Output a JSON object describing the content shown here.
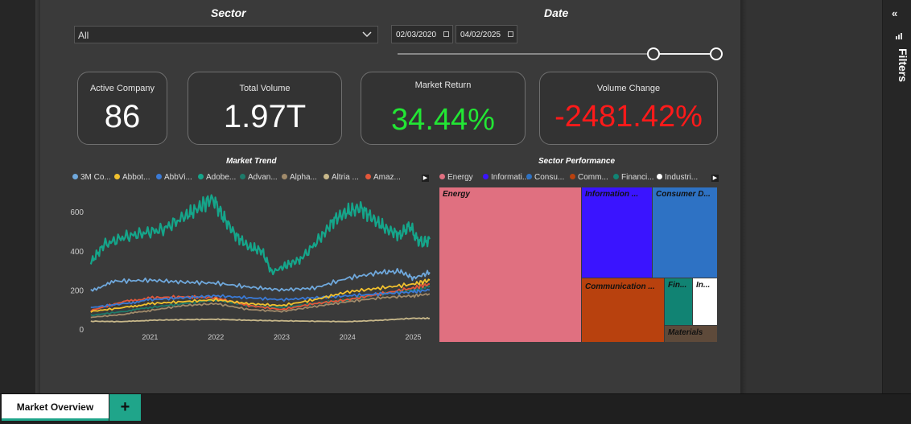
{
  "slicers": {
    "sector_title": "Sector",
    "sector_value": "All",
    "date_title": "Date",
    "date_start": "02/03/2020",
    "date_end": "04/02/2025",
    "range_start_fraction": 0.81,
    "range_end_fraction": 1.0
  },
  "kpis": {
    "active_company": {
      "label": "Active Company",
      "value": "86"
    },
    "total_volume": {
      "label": "Total Volume",
      "value": "1.97T"
    },
    "market_return": {
      "label": "Market Return",
      "value": "34.44%",
      "color": "#22e634"
    },
    "volume_change": {
      "label": "Volume Change",
      "value": "-2481.42%",
      "color": "#ff1a1a"
    }
  },
  "market_trend": {
    "title": "Market Trend",
    "legend": [
      {
        "name": "3M Co...",
        "color": "#6fa8dc"
      },
      {
        "name": "Abbot...",
        "color": "#f2c12e"
      },
      {
        "name": "AbbVi...",
        "color": "#3a7ad6"
      },
      {
        "name": "Adobe...",
        "color": "#15a58a"
      },
      {
        "name": "Advan...",
        "color": "#1e7a6a"
      },
      {
        "name": "Alpha...",
        "color": "#a08a6a"
      },
      {
        "name": "Altria ...",
        "color": "#c8b88a"
      },
      {
        "name": "Amaz...",
        "color": "#e4573a"
      }
    ]
  },
  "sector_performance": {
    "title": "Sector Performance",
    "legend": [
      {
        "name": "Energy",
        "color": "#e07080"
      },
      {
        "name": "Informati...",
        "color": "#3a14ff"
      },
      {
        "name": "Consu...",
        "color": "#2e72c4"
      },
      {
        "name": "Comm...",
        "color": "#b8410e"
      },
      {
        "name": "Financi...",
        "color": "#118373"
      },
      {
        "name": "Industri...",
        "color": "#ffffff"
      }
    ],
    "cells": {
      "energy": "Energy",
      "information": "Information ...",
      "consumer": "Consumer D...",
      "communication": "Communication ...",
      "financials": "Fin...",
      "industrials": "In...",
      "materials": "Materials"
    }
  },
  "chart_data": {
    "type": "line",
    "title": "Market Trend",
    "xlabel": "",
    "ylabel": "",
    "x_ticks": [
      "2021",
      "2022",
      "2023",
      "2024",
      "2025"
    ],
    "y_ticks": [
      0,
      200,
      400,
      600
    ],
    "ylim": [
      0,
      720
    ],
    "xlim": [
      "2020-02-03",
      "2025-04-02"
    ],
    "series": [
      {
        "name": "3M Co...",
        "color": "#6fa8dc",
        "x": [
          2020.1,
          2020.5,
          2021.0,
          2021.5,
          2022.0,
          2022.5,
          2023.0,
          2023.5,
          2024.0,
          2024.5,
          2024.8,
          2025.0,
          2025.25
        ],
        "y": [
          200,
          245,
          250,
          240,
          235,
          215,
          200,
          210,
          260,
          290,
          295,
          260,
          290
        ]
      },
      {
        "name": "Abbot...",
        "color": "#f2c12e",
        "x": [
          2020.1,
          2020.6,
          2021.0,
          2021.5,
          2022.0,
          2022.5,
          2023.0,
          2023.5,
          2024.0,
          2024.5,
          2025.0,
          2025.25
        ],
        "y": [
          90,
          110,
          130,
          140,
          150,
          130,
          120,
          150,
          190,
          210,
          230,
          250
        ]
      },
      {
        "name": "AbbVi...",
        "color": "#3a7ad6",
        "x": [
          2020.1,
          2020.6,
          2021.0,
          2021.5,
          2022.0,
          2022.5,
          2023.0,
          2023.5,
          2024.0,
          2024.5,
          2025.0,
          2025.25
        ],
        "y": [
          110,
          130,
          150,
          160,
          170,
          160,
          150,
          160,
          170,
          180,
          190,
          200
        ]
      },
      {
        "name": "Adobe...",
        "color": "#15a58a",
        "x": [
          2020.1,
          2020.3,
          2020.6,
          2020.9,
          2021.2,
          2021.5,
          2021.7,
          2021.95,
          2022.1,
          2022.3,
          2022.5,
          2022.7,
          2022.85,
          2023.1,
          2023.3,
          2023.6,
          2023.8,
          2024.0,
          2024.2,
          2024.4,
          2024.6,
          2024.8,
          2024.95,
          2025.05,
          2025.15,
          2025.25
        ],
        "y": [
          340,
          430,
          470,
          490,
          510,
          570,
          610,
          670,
          580,
          480,
          420,
          400,
          290,
          330,
          360,
          470,
          560,
          600,
          620,
          560,
          510,
          480,
          530,
          460,
          440,
          460
        ]
      },
      {
        "name": "Advan...",
        "color": "#1e7a6a",
        "x": [
          2020.1,
          2020.6,
          2021.0,
          2021.5,
          2022.0,
          2022.5,
          2023.0,
          2023.5,
          2024.0,
          2024.5,
          2025.0,
          2025.25
        ],
        "y": [
          70,
          90,
          110,
          130,
          150,
          120,
          110,
          130,
          150,
          180,
          200,
          220
        ]
      },
      {
        "name": "Alpha...",
        "color": "#a08a6a",
        "x": [
          2020.1,
          2020.6,
          2021.0,
          2021.5,
          2022.0,
          2022.5,
          2023.0,
          2023.5,
          2024.0,
          2024.5,
          2025.0,
          2025.25
        ],
        "y": [
          60,
          75,
          95,
          120,
          130,
          100,
          90,
          115,
          140,
          160,
          170,
          180
        ]
      },
      {
        "name": "Altria ...",
        "color": "#c8b88a",
        "x": [
          2020.1,
          2020.6,
          2021.0,
          2021.5,
          2022.0,
          2022.5,
          2023.0,
          2023.5,
          2024.0,
          2024.5,
          2025.0,
          2025.25
        ],
        "y": [
          40,
          38,
          45,
          48,
          50,
          45,
          42,
          40,
          38,
          45,
          55,
          55
        ]
      },
      {
        "name": "Amaz...",
        "color": "#e4573a",
        "x": [
          2020.1,
          2020.6,
          2021.0,
          2021.5,
          2022.0,
          2022.5,
          2023.0,
          2023.5,
          2024.0,
          2024.5,
          2025.0,
          2025.25
        ],
        "y": [
          95,
          140,
          160,
          165,
          160,
          120,
          100,
          130,
          150,
          180,
          210,
          230
        ]
      }
    ]
  },
  "tabs": {
    "active": "Market Overview",
    "add": "+"
  }
}
